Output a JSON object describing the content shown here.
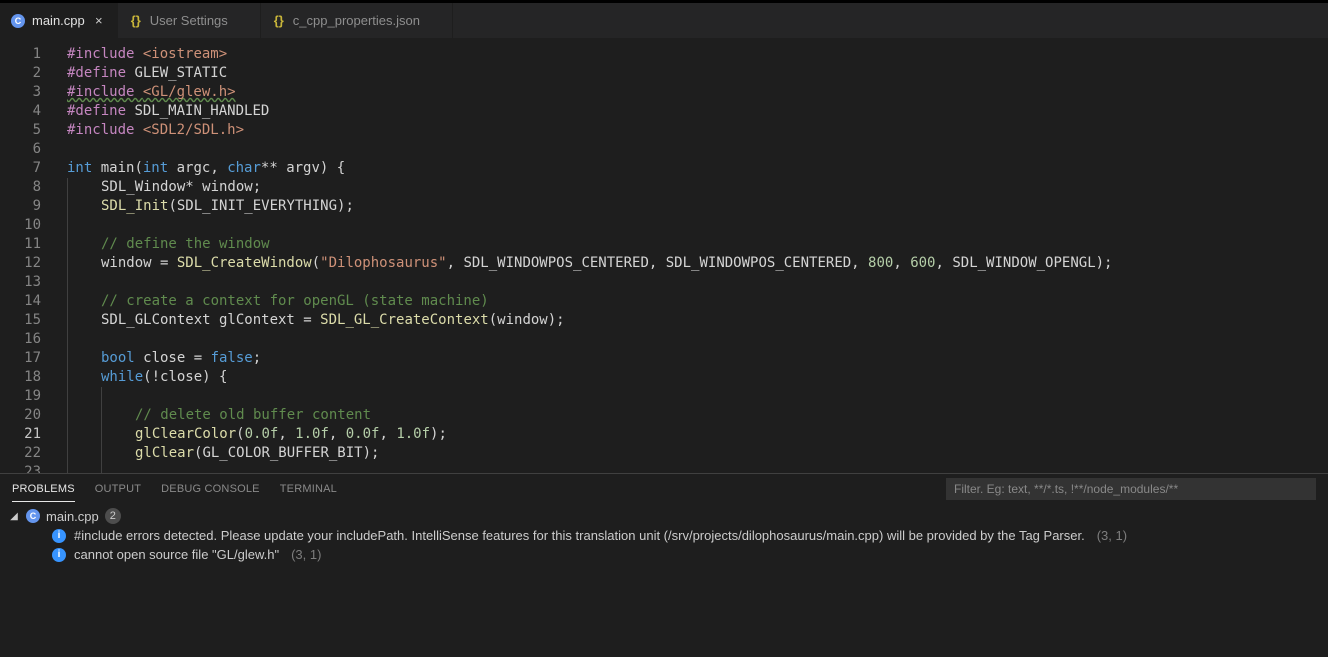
{
  "tabs": [
    {
      "label": "main.cpp",
      "kind": "cpp",
      "active": true,
      "dirty": true
    },
    {
      "label": "User Settings",
      "kind": "json",
      "active": false,
      "dirty": false
    },
    {
      "label": "c_cpp_properties.json",
      "kind": "json",
      "active": false,
      "dirty": false
    }
  ],
  "editor": {
    "current_line": 21,
    "lines": [
      {
        "n": 1,
        "tokens": [
          [
            "#include",
            "tok-inc"
          ],
          [
            " ",
            "tok-def"
          ],
          [
            "<iostream>",
            "tok-str"
          ]
        ]
      },
      {
        "n": 2,
        "tokens": [
          [
            "#define",
            "tok-inc"
          ],
          [
            " ",
            "tok-def"
          ],
          [
            "GLEW_STATIC",
            "tok-id"
          ]
        ]
      },
      {
        "n": 3,
        "tokens": [
          [
            "#include ",
            "tok-inc squiggle"
          ],
          [
            "<GL/glew.h>",
            "tok-str squiggle"
          ]
        ]
      },
      {
        "n": 4,
        "tokens": [
          [
            "#define",
            "tok-inc"
          ],
          [
            " ",
            "tok-def"
          ],
          [
            "SDL_MAIN_HANDLED",
            "tok-id"
          ]
        ]
      },
      {
        "n": 5,
        "tokens": [
          [
            "#include",
            "tok-inc"
          ],
          [
            " ",
            "tok-def"
          ],
          [
            "<SDL2/SDL.h>",
            "tok-str"
          ]
        ]
      },
      {
        "n": 6,
        "tokens": []
      },
      {
        "n": 7,
        "tokens": [
          [
            "int",
            "tok-kw"
          ],
          [
            " main(",
            "tok-id"
          ],
          [
            "int",
            "tok-kw"
          ],
          [
            " argc, ",
            "tok-id"
          ],
          [
            "char",
            "tok-kw"
          ],
          [
            "** argv) {",
            "tok-id"
          ]
        ]
      },
      {
        "n": 8,
        "indent": 1,
        "tokens": [
          [
            "SDL_Window* window;",
            "tok-id"
          ]
        ]
      },
      {
        "n": 9,
        "indent": 1,
        "tokens": [
          [
            "SDL_Init",
            "tok-fn"
          ],
          [
            "(SDL_INIT_EVERYTHING);",
            "tok-id"
          ]
        ]
      },
      {
        "n": 10,
        "indent": 1,
        "tokens": []
      },
      {
        "n": 11,
        "indent": 1,
        "tokens": [
          [
            "// define the window",
            "tok-com"
          ]
        ]
      },
      {
        "n": 12,
        "indent": 1,
        "tokens": [
          [
            "window = ",
            "tok-id"
          ],
          [
            "SDL_CreateWindow",
            "tok-fn"
          ],
          [
            "(",
            "tok-id"
          ],
          [
            "\"Dilophosaurus\"",
            "tok-str"
          ],
          [
            ", SDL_WINDOWPOS_CENTERED, SDL_WINDOWPOS_CENTERED, ",
            "tok-id"
          ],
          [
            "800",
            "tok-num"
          ],
          [
            ", ",
            "tok-id"
          ],
          [
            "600",
            "tok-num"
          ],
          [
            ", SDL_WINDOW_OPENGL);",
            "tok-id"
          ]
        ]
      },
      {
        "n": 13,
        "indent": 1,
        "tokens": []
      },
      {
        "n": 14,
        "indent": 1,
        "tokens": [
          [
            "// create a context for openGL (state machine)",
            "tok-com"
          ]
        ]
      },
      {
        "n": 15,
        "indent": 1,
        "tokens": [
          [
            "SDL_GLContext glContext = ",
            "tok-id"
          ],
          [
            "SDL_GL_CreateContext",
            "tok-fn"
          ],
          [
            "(window);",
            "tok-id"
          ]
        ]
      },
      {
        "n": 16,
        "indent": 1,
        "tokens": []
      },
      {
        "n": 17,
        "indent": 1,
        "tokens": [
          [
            "bool",
            "tok-kw"
          ],
          [
            " close = ",
            "tok-id"
          ],
          [
            "false",
            "tok-kw"
          ],
          [
            ";",
            "tok-id"
          ]
        ]
      },
      {
        "n": 18,
        "indent": 1,
        "tokens": [
          [
            "while",
            "tok-kw"
          ],
          [
            "(!close) {",
            "tok-id"
          ]
        ]
      },
      {
        "n": 19,
        "indent": 2,
        "tokens": []
      },
      {
        "n": 20,
        "indent": 2,
        "tokens": [
          [
            "// delete old buffer content",
            "tok-com"
          ]
        ]
      },
      {
        "n": 21,
        "indent": 2,
        "tokens": [
          [
            "glClearColor",
            "tok-fn"
          ],
          [
            "(",
            "tok-id"
          ],
          [
            "0.0f",
            "tok-num"
          ],
          [
            ", ",
            "tok-id"
          ],
          [
            "1.0f",
            "tok-num"
          ],
          [
            ", ",
            "tok-id"
          ],
          [
            "0.0f",
            "tok-num"
          ],
          [
            ", ",
            "tok-id"
          ],
          [
            "1.0f",
            "tok-num"
          ],
          [
            ");",
            "tok-id"
          ]
        ]
      },
      {
        "n": 22,
        "indent": 2,
        "tokens": [
          [
            "glClear",
            "tok-fn"
          ],
          [
            "(GL_COLOR_BUFFER_BIT);",
            "tok-id"
          ]
        ]
      },
      {
        "n": 23,
        "indent": 2,
        "tokens": []
      }
    ]
  },
  "panel": {
    "tabs": [
      "PROBLEMS",
      "OUTPUT",
      "DEBUG CONSOLE",
      "TERMINAL"
    ],
    "active_tab": 0,
    "filter_placeholder": "Filter. Eg: text, **/*.ts, !**/node_modules/**"
  },
  "problems": {
    "file": "main.cpp",
    "count": "2",
    "items": [
      {
        "message": "#include errors detected. Please update your includePath. IntelliSense features for this translation unit (/srv/projects/dilophosaurus/main.cpp) will be provided by the Tag Parser.",
        "pos": "(3, 1)"
      },
      {
        "message": "cannot open source file \"GL/glew.h\"",
        "pos": "(3, 1)"
      }
    ]
  }
}
